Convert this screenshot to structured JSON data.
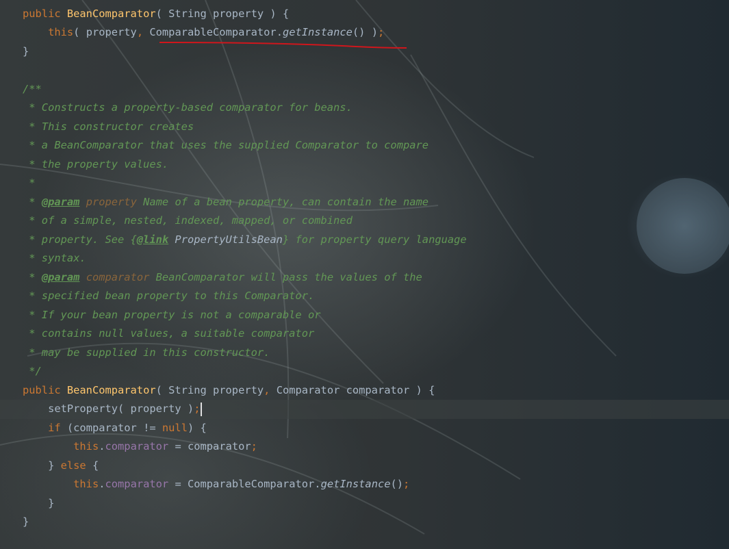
{
  "editor": {
    "language": "java",
    "lines": [
      {
        "tokens": [
          [
            "kw",
            "public "
          ],
          [
            "fn",
            "BeanComparator"
          ],
          [
            "txt",
            "( String property ) {"
          ]
        ]
      },
      {
        "tokens": [
          [
            "txt",
            "    "
          ],
          [
            "kw",
            "this"
          ],
          [
            "txt",
            "( property"
          ],
          [
            "kw",
            ", "
          ],
          [
            "txt",
            "ComparableComparator."
          ],
          [
            "it",
            "getInstance"
          ],
          [
            "txt",
            "() )"
          ],
          [
            "kw",
            ";"
          ]
        ]
      },
      {
        "tokens": [
          [
            "txt",
            "}"
          ]
        ]
      },
      {
        "tokens": []
      },
      {
        "tokens": [
          [
            "cm",
            "/**"
          ]
        ]
      },
      {
        "tokens": [
          [
            "cm",
            " * Constructs a property-based comparator for beans."
          ]
        ]
      },
      {
        "tokens": [
          [
            "cm",
            " * This constructor creates"
          ]
        ]
      },
      {
        "tokens": [
          [
            "cm",
            " * a BeanComparator that uses the supplied Comparator to compare"
          ]
        ]
      },
      {
        "tokens": [
          [
            "cm",
            " * the property values."
          ]
        ]
      },
      {
        "tokens": [
          [
            "cm",
            " *"
          ]
        ]
      },
      {
        "tokens": [
          [
            "cm",
            " * "
          ],
          [
            "tag",
            "@param"
          ],
          [
            "cm",
            " "
          ],
          [
            "param",
            "property"
          ],
          [
            "cm",
            " Name of a bean property, can contain the name"
          ]
        ]
      },
      {
        "tokens": [
          [
            "cm",
            " * of a simple, nested, indexed, mapped, or combined"
          ]
        ]
      },
      {
        "tokens": [
          [
            "cm",
            " * property. See {"
          ],
          [
            "tag",
            "@link"
          ],
          [
            "cm",
            " "
          ],
          [
            "ref",
            "PropertyUtilsBean"
          ],
          [
            "cm",
            "} for property query language"
          ]
        ]
      },
      {
        "tokens": [
          [
            "cm",
            " * syntax."
          ]
        ]
      },
      {
        "tokens": [
          [
            "cm",
            " * "
          ],
          [
            "tag",
            "@param"
          ],
          [
            "cm",
            " "
          ],
          [
            "param",
            "comparator"
          ],
          [
            "cm",
            " BeanComparator will pass the values of the"
          ]
        ]
      },
      {
        "tokens": [
          [
            "cm",
            " * specified bean property to this Comparator."
          ]
        ]
      },
      {
        "tokens": [
          [
            "cm",
            " * If your bean property is not a comparable or"
          ]
        ]
      },
      {
        "tokens": [
          [
            "cm",
            " * contains null values, a suitable comparator"
          ]
        ]
      },
      {
        "tokens": [
          [
            "cm",
            " * may be supplied in this constructor."
          ]
        ]
      },
      {
        "tokens": [
          [
            "cm",
            " */"
          ]
        ]
      },
      {
        "tokens": [
          [
            "kw",
            "public "
          ],
          [
            "fn",
            "BeanComparator"
          ],
          [
            "txt",
            "( String property"
          ],
          [
            "kw",
            ", "
          ],
          [
            "txt",
            "Comparator comparator ) {"
          ]
        ]
      },
      {
        "tokens": [
          [
            "txt",
            "    setProperty( property )"
          ],
          [
            "kw",
            ";"
          ],
          [
            "caret",
            ""
          ]
        ],
        "current": true
      },
      {
        "tokens": [
          [
            "txt",
            "    "
          ],
          [
            "kw",
            "if "
          ],
          [
            "txt",
            "(comparator != "
          ],
          [
            "kw",
            "null"
          ],
          [
            "txt",
            ") {"
          ]
        ]
      },
      {
        "tokens": [
          [
            "txt",
            "        "
          ],
          [
            "kw",
            "this"
          ],
          [
            "txt",
            "."
          ],
          [
            "field",
            "comparator"
          ],
          [
            "txt",
            " = comparator"
          ],
          [
            "kw",
            ";"
          ]
        ]
      },
      {
        "tokens": [
          [
            "txt",
            "    } "
          ],
          [
            "kw",
            "else "
          ],
          [
            "txt",
            "{"
          ]
        ]
      },
      {
        "tokens": [
          [
            "txt",
            "        "
          ],
          [
            "kw",
            "this"
          ],
          [
            "txt",
            "."
          ],
          [
            "field",
            "comparator"
          ],
          [
            "txt",
            " = ComparableComparator."
          ],
          [
            "it",
            "getInstance"
          ],
          [
            "txt",
            "()"
          ],
          [
            "kw",
            ";"
          ]
        ]
      },
      {
        "tokens": [
          [
            "txt",
            "    }"
          ]
        ]
      },
      {
        "tokens": [
          [
            "txt",
            "}"
          ]
        ]
      }
    ]
  },
  "annotation": {
    "color": "#d0161c",
    "marked_text": "ComparableComparator.getInstance() );"
  }
}
